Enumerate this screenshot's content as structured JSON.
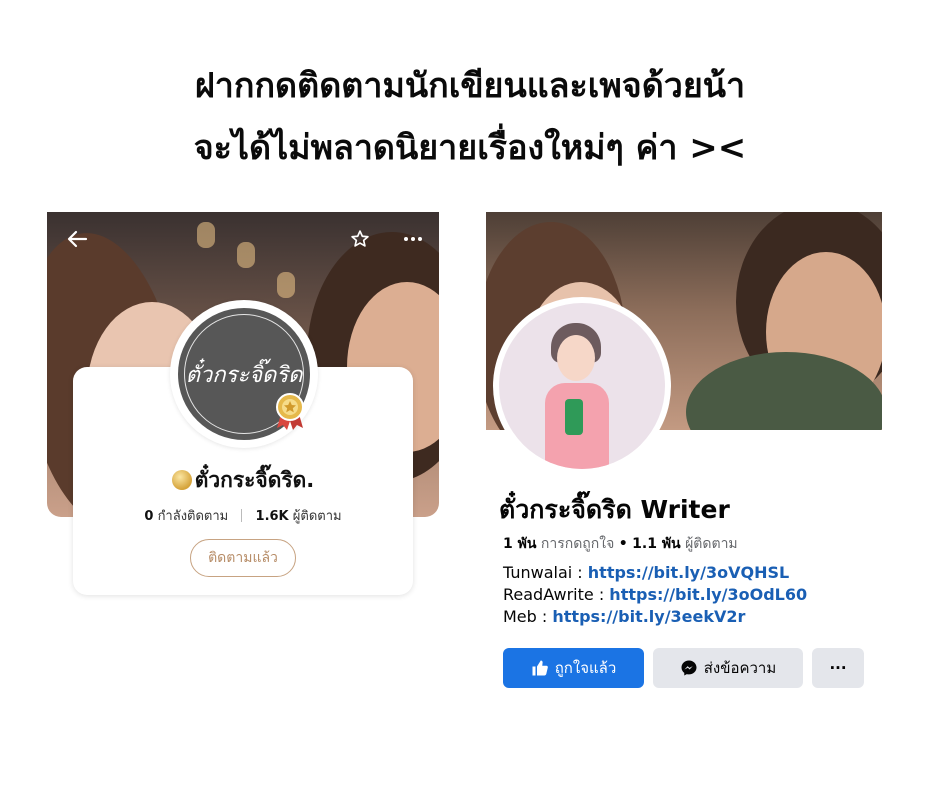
{
  "headline": {
    "line1": "ฝากกดติดตามนักเขียนและเพจด้วยน้า",
    "line2": "จะได้ไม่พลาดนิยายเรื่องใหม่ๆ ค่า ><"
  },
  "app_profile": {
    "avatar_logo_text": "ตั๋วกระจิ๊ดริด",
    "name": "ตั๋วกระจิ๊ดริด.",
    "following_count": "0",
    "following_label": "กำลังติดตาม",
    "followers_count": "1.6K",
    "followers_label": "ผู้ติดตาม",
    "follow_button_label": "ติดตามแล้ว",
    "icons": [
      "back-arrow-icon",
      "star-icon",
      "more-icon",
      "medal-icon"
    ],
    "accent_color": "#c7a382"
  },
  "facebook_page": {
    "title": "ตั๋วกระจิ๊ดริด Writer",
    "likes_count": "1 พัน",
    "likes_label": "การกดถูกใจ",
    "dot": "•",
    "followers_count": "1.1 พัน",
    "followers_label": "ผู้ติดตาม",
    "links": [
      {
        "label": "Tunwalai : ",
        "url": "https://bit.ly/3oVQHSL"
      },
      {
        "label": "ReadAwrite : ",
        "url": "https://bit.ly/3oOdL60"
      },
      {
        "label": "Meb : ",
        "url": "https://bit.ly/3eekV2r"
      }
    ],
    "buttons": {
      "liked_label": "ถูกใจแล้ว",
      "message_label": "ส่งข้อความ",
      "more_label": "···"
    },
    "colors": {
      "primary": "#1b74e4",
      "secondary": "#e4e6eb",
      "link": "#1a5fb4"
    }
  }
}
